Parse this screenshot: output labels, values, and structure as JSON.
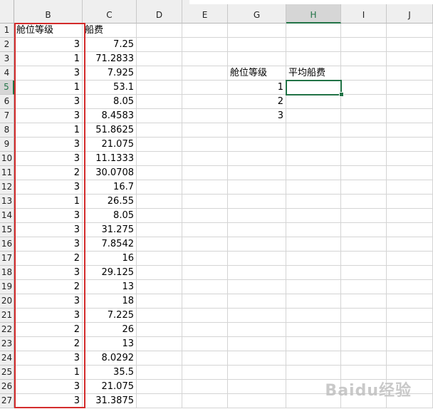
{
  "columns": [
    "B",
    "C",
    "D",
    "E",
    "G",
    "H",
    "I",
    "J"
  ],
  "selected_cell": {
    "column": "H",
    "row": 5
  },
  "rows": [
    {
      "row": "1",
      "b": "舱位等级",
      "c": "船费"
    },
    {
      "row": "2",
      "b": "3",
      "c": "7.25"
    },
    {
      "row": "3",
      "b": "1",
      "c": "71.2833"
    },
    {
      "row": "4",
      "b": "3",
      "c": "7.925"
    },
    {
      "row": "5",
      "b": "1",
      "c": "53.1"
    },
    {
      "row": "6",
      "b": "3",
      "c": "8.05"
    },
    {
      "row": "7",
      "b": "3",
      "c": "8.4583"
    },
    {
      "row": "8",
      "b": "1",
      "c": "51.8625"
    },
    {
      "row": "9",
      "b": "3",
      "c": "21.075"
    },
    {
      "row": "10",
      "b": "3",
      "c": "11.1333"
    },
    {
      "row": "11",
      "b": "2",
      "c": "30.0708"
    },
    {
      "row": "12",
      "b": "3",
      "c": "16.7"
    },
    {
      "row": "13",
      "b": "1",
      "c": "26.55"
    },
    {
      "row": "14",
      "b": "3",
      "c": "8.05"
    },
    {
      "row": "15",
      "b": "3",
      "c": "31.275"
    },
    {
      "row": "16",
      "b": "3",
      "c": "7.8542"
    },
    {
      "row": "17",
      "b": "2",
      "c": "16"
    },
    {
      "row": "18",
      "b": "3",
      "c": "29.125"
    },
    {
      "row": "19",
      "b": "2",
      "c": "13"
    },
    {
      "row": "20",
      "b": "3",
      "c": "18"
    },
    {
      "row": "21",
      "b": "3",
      "c": "7.225"
    },
    {
      "row": "22",
      "b": "2",
      "c": "26"
    },
    {
      "row": "23",
      "b": "2",
      "c": "13"
    },
    {
      "row": "24",
      "b": "3",
      "c": "8.0292"
    },
    {
      "row": "25",
      "b": "1",
      "c": "35.5"
    },
    {
      "row": "26",
      "b": "3",
      "c": "21.075"
    },
    {
      "row": "27",
      "b": "3",
      "c": "31.3875"
    }
  ],
  "summary_table": {
    "header_g": "舱位等级",
    "header_h": "平均船费",
    "classes": [
      "1",
      "2",
      "3"
    ]
  },
  "colors": {
    "highlight_border": "#d32b2b",
    "selection_border": "#217346"
  },
  "watermark": "Baidu经验"
}
